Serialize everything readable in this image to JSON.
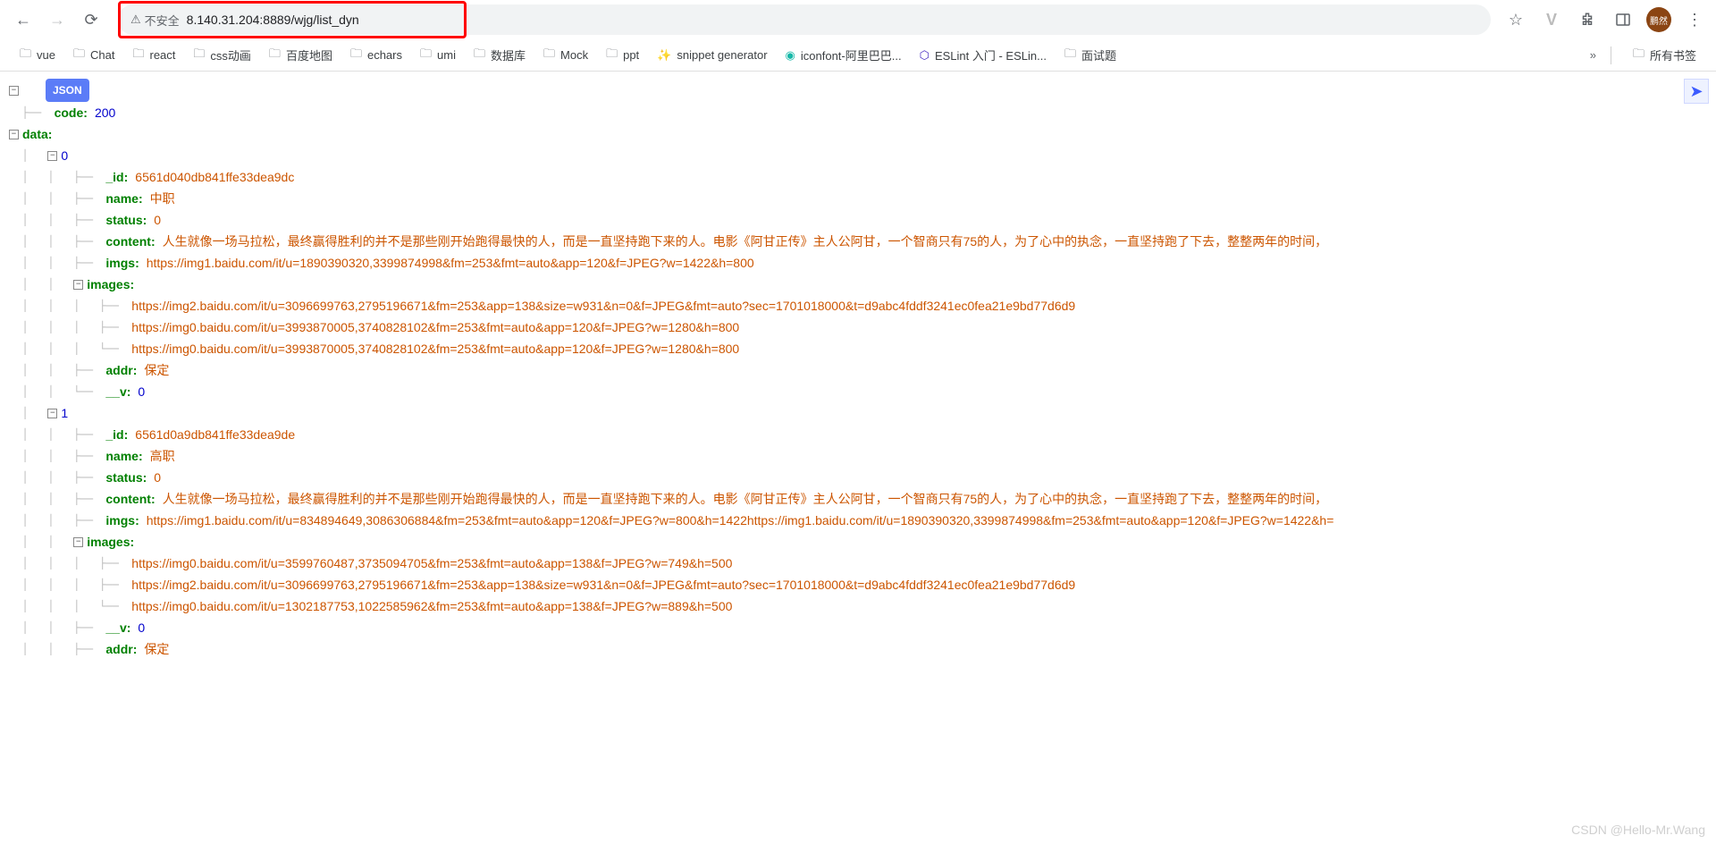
{
  "browser": {
    "security_label": "不安全",
    "url": "8.140.31.204:8889/wjg/list_dyn"
  },
  "bookmarks": [
    {
      "label": "vue",
      "type": "folder"
    },
    {
      "label": "Chat",
      "type": "folder"
    },
    {
      "label": "react",
      "type": "folder"
    },
    {
      "label": "css动画",
      "type": "folder"
    },
    {
      "label": "百度地图",
      "type": "folder"
    },
    {
      "label": "echars",
      "type": "folder"
    },
    {
      "label": "umi",
      "type": "folder"
    },
    {
      "label": "数据库",
      "type": "folder"
    },
    {
      "label": "Mock",
      "type": "folder"
    },
    {
      "label": "ppt",
      "type": "folder"
    },
    {
      "label": "snippet generator",
      "type": "link"
    },
    {
      "label": "iconfont-阿里巴巴...",
      "type": "link"
    },
    {
      "label": "ESLint 入门 - ESLin...",
      "type": "link"
    },
    {
      "label": "面试题",
      "type": "folder"
    }
  ],
  "all_bookmarks_label": "所有书签",
  "json": {
    "badge": "JSON",
    "code_key": "code",
    "code_val": "200",
    "data_key": "data",
    "items": [
      {
        "idx": "0",
        "_id": {
          "k": "_id",
          "v": "6561d040db841ffe33dea9dc"
        },
        "name": {
          "k": "name",
          "v": "中职"
        },
        "status": {
          "k": "status",
          "v": "0"
        },
        "content": {
          "k": "content",
          "v": "人生就像一场马拉松，最终赢得胜利的并不是那些刚开始跑得最快的人，而是一直坚持跑下来的人。电影《阿甘正传》主人公阿甘，一个智商只有75的人，为了心中的执念，一直坚持跑了下去，整整两年的时间，"
        },
        "imgs": {
          "k": "imgs",
          "v": "https://img1.baidu.com/it/u=1890390320,3399874998&fm=253&fmt=auto&app=120&f=JPEG?w=1422&h=800"
        },
        "images": {
          "k": "images",
          "list": [
            "https://img2.baidu.com/it/u=3096699763,2795196671&fm=253&app=138&size=w931&n=0&f=JPEG&fmt=auto?sec=1701018000&t=d9abc4fddf3241ec0fea21e9bd77d6d9",
            "https://img0.baidu.com/it/u=3993870005,3740828102&fm=253&fmt=auto&app=120&f=JPEG?w=1280&h=800",
            "https://img0.baidu.com/it/u=3993870005,3740828102&fm=253&fmt=auto&app=120&f=JPEG?w=1280&h=800"
          ]
        },
        "addr": {
          "k": "addr",
          "v": "保定"
        },
        "__v": {
          "k": "__v",
          "v": "0"
        }
      },
      {
        "idx": "1",
        "_id": {
          "k": "_id",
          "v": "6561d0a9db841ffe33dea9de"
        },
        "name": {
          "k": "name",
          "v": "高职"
        },
        "status": {
          "k": "status",
          "v": "0"
        },
        "content": {
          "k": "content",
          "v": "人生就像一场马拉松，最终赢得胜利的并不是那些刚开始跑得最快的人，而是一直坚持跑下来的人。电影《阿甘正传》主人公阿甘，一个智商只有75的人，为了心中的执念，一直坚持跑了下去，整整两年的时间，"
        },
        "imgs": {
          "k": "imgs",
          "v": "https://img1.baidu.com/it/u=834894649,3086306884&fm=253&fmt=auto&app=120&f=JPEG?w=800&h=1422https://img1.baidu.com/it/u=1890390320,3399874998&fm=253&fmt=auto&app=120&f=JPEG?w=1422&h="
        },
        "images": {
          "k": "images",
          "list": [
            "https://img0.baidu.com/it/u=3599760487,3735094705&fm=253&fmt=auto&app=138&f=JPEG?w=749&h=500",
            "https://img2.baidu.com/it/u=3096699763,2795196671&fm=253&app=138&size=w931&n=0&f=JPEG&fmt=auto?sec=1701018000&t=d9abc4fddf3241ec0fea21e9bd77d6d9",
            "https://img0.baidu.com/it/u=1302187753,1022585962&fm=253&fmt=auto&app=138&f=JPEG?w=889&h=500"
          ]
        },
        "__v": {
          "k": "__v",
          "v": "0"
        },
        "addr": {
          "k": "addr",
          "v": "保定"
        }
      }
    ]
  },
  "watermark": "CSDN @Hello-Mr.Wang"
}
